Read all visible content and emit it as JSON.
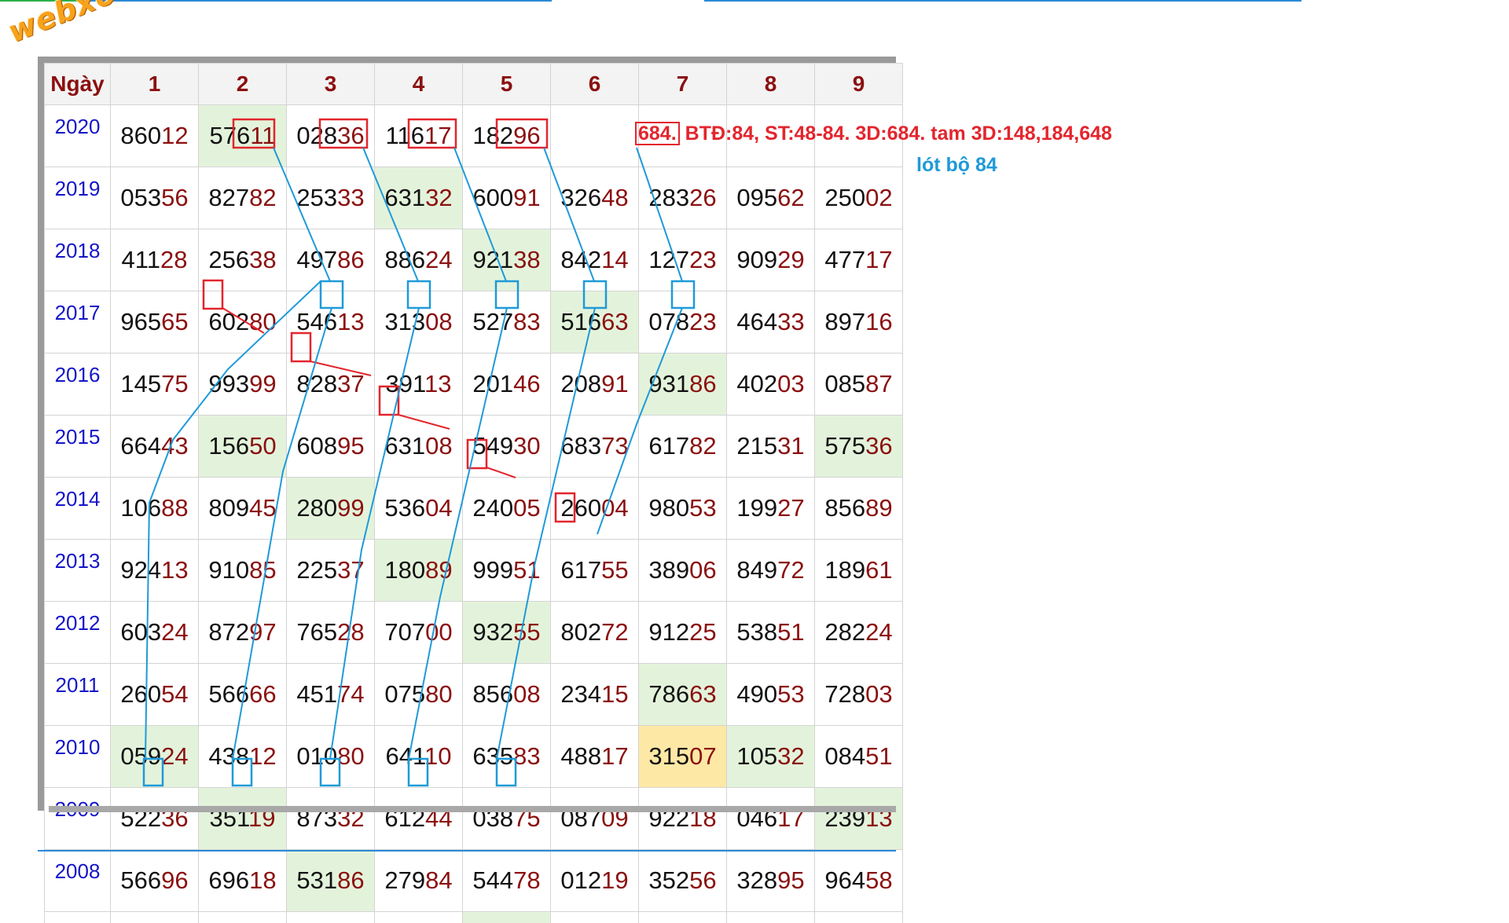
{
  "logo_text": "webxoso.net",
  "header": [
    "Ngày",
    "1",
    "2",
    "3",
    "4",
    "5",
    "6",
    "7",
    "8",
    "9"
  ],
  "rows": [
    {
      "year": "2020",
      "cells": [
        {
          "head": "860",
          "tail": "12"
        },
        {
          "head": "576",
          "tail": "11",
          "bg": "green"
        },
        {
          "head": "028",
          "tail": "36"
        },
        {
          "head": "116",
          "tail": "17"
        },
        {
          "head": "182",
          "tail": "96"
        }
      ]
    },
    {
      "year": "2019",
      "cells": [
        {
          "head": "053",
          "tail": "56"
        },
        {
          "head": "827",
          "tail": "82"
        },
        {
          "head": "253",
          "tail": "33"
        },
        {
          "head": "631",
          "tail": "32",
          "bg": "green"
        },
        {
          "head": "600",
          "tail": "91"
        },
        {
          "head": "326",
          "tail": "48"
        },
        {
          "head": "283",
          "tail": "26"
        },
        {
          "head": "095",
          "tail": "62"
        },
        {
          "head": "250",
          "tail": "02"
        }
      ]
    },
    {
      "year": "2018",
      "cells": [
        {
          "head": "411",
          "tail": "28"
        },
        {
          "head": "256",
          "tail": "38"
        },
        {
          "head": "497",
          "tail": "86"
        },
        {
          "head": "886",
          "tail": "24"
        },
        {
          "head": "921",
          "tail": "38",
          "bg": "green"
        },
        {
          "head": "842",
          "tail": "14"
        },
        {
          "head": "127",
          "tail": "23"
        },
        {
          "head": "909",
          "tail": "29"
        },
        {
          "head": "477",
          "tail": "17"
        }
      ]
    },
    {
      "year": "2017",
      "cells": [
        {
          "head": "965",
          "tail": "65"
        },
        {
          "head": "602",
          "tail": "80"
        },
        {
          "head": "546",
          "tail": "13"
        },
        {
          "head": "313",
          "tail": "08"
        },
        {
          "head": "527",
          "tail": "83"
        },
        {
          "head": "516",
          "tail": "63",
          "bg": "green"
        },
        {
          "head": "078",
          "tail": "23"
        },
        {
          "head": "464",
          "tail": "33"
        },
        {
          "head": "897",
          "tail": "16"
        }
      ]
    },
    {
      "year": "2016",
      "cells": [
        {
          "head": "145",
          "tail": "75"
        },
        {
          "head": "993",
          "tail": "99"
        },
        {
          "head": "828",
          "tail": "37"
        },
        {
          "head": "391",
          "tail": "13"
        },
        {
          "head": "201",
          "tail": "46"
        },
        {
          "head": "208",
          "tail": "91"
        },
        {
          "head": "931",
          "tail": "86",
          "bg": "green"
        },
        {
          "head": "402",
          "tail": "03"
        },
        {
          "head": "085",
          "tail": "87"
        }
      ]
    },
    {
      "year": "2015",
      "cells": [
        {
          "head": "664",
          "tail": "43"
        },
        {
          "head": "156",
          "tail": "50",
          "bg": "green"
        },
        {
          "head": "608",
          "tail": "95"
        },
        {
          "head": "631",
          "tail": "08"
        },
        {
          "head": "549",
          "tail": "30"
        },
        {
          "head": "683",
          "tail": "73"
        },
        {
          "head": "617",
          "tail": "82"
        },
        {
          "head": "215",
          "tail": "31"
        },
        {
          "head": "575",
          "tail": "36",
          "bg": "green"
        }
      ]
    },
    {
      "year": "2014",
      "cells": [
        {
          "head": "106",
          "tail": "88"
        },
        {
          "head": "809",
          "tail": "45"
        },
        {
          "head": "280",
          "tail": "99",
          "bg": "green"
        },
        {
          "head": "536",
          "tail": "04"
        },
        {
          "head": "240",
          "tail": "05"
        },
        {
          "head": "260",
          "tail": "04"
        },
        {
          "head": "980",
          "tail": "53"
        },
        {
          "head": "199",
          "tail": "27"
        },
        {
          "head": "856",
          "tail": "89"
        }
      ]
    },
    {
      "year": "2013",
      "cells": [
        {
          "head": "924",
          "tail": "13"
        },
        {
          "head": "910",
          "tail": "85"
        },
        {
          "head": "225",
          "tail": "37"
        },
        {
          "head": "180",
          "tail": "89",
          "bg": "green"
        },
        {
          "head": "999",
          "tail": "51"
        },
        {
          "head": "617",
          "tail": "55"
        },
        {
          "head": "389",
          "tail": "06"
        },
        {
          "head": "849",
          "tail": "72"
        },
        {
          "head": "189",
          "tail": "61"
        }
      ]
    },
    {
      "year": "2012",
      "cells": [
        {
          "head": "603",
          "tail": "24"
        },
        {
          "head": "872",
          "tail": "97"
        },
        {
          "head": "765",
          "tail": "28"
        },
        {
          "head": "707",
          "tail": "00"
        },
        {
          "head": "932",
          "tail": "55",
          "bg": "green"
        },
        {
          "head": "802",
          "tail": "72"
        },
        {
          "head": "912",
          "tail": "25"
        },
        {
          "head": "538",
          "tail": "51"
        },
        {
          "head": "282",
          "tail": "24"
        }
      ]
    },
    {
      "year": "2011",
      "cells": [
        {
          "head": "260",
          "tail": "54"
        },
        {
          "head": "566",
          "tail": "66"
        },
        {
          "head": "451",
          "tail": "74"
        },
        {
          "head": "075",
          "tail": "80"
        },
        {
          "head": "856",
          "tail": "08"
        },
        {
          "head": "234",
          "tail": "15"
        },
        {
          "head": "786",
          "tail": "63",
          "bg": "green"
        },
        {
          "head": "490",
          "tail": "53"
        },
        {
          "head": "728",
          "tail": "03"
        }
      ]
    },
    {
      "year": "2010",
      "cells": [
        {
          "head": "059",
          "tail": "24",
          "bg": "green"
        },
        {
          "head": "438",
          "tail": "12"
        },
        {
          "head": "010",
          "tail": "80"
        },
        {
          "head": "641",
          "tail": "10"
        },
        {
          "head": "635",
          "tail": "83"
        },
        {
          "head": "488",
          "tail": "17"
        },
        {
          "head": "315",
          "tail": "07",
          "bg": "yellow"
        },
        {
          "head": "105",
          "tail": "32",
          "bg": "green"
        },
        {
          "head": "084",
          "tail": "51"
        }
      ]
    },
    {
      "year": "2009",
      "cells": [
        {
          "head": "522",
          "tail": "36"
        },
        {
          "head": "351",
          "tail": "19",
          "bg": "green"
        },
        {
          "head": "873",
          "tail": "32"
        },
        {
          "head": "612",
          "tail": "44"
        },
        {
          "head": "038",
          "tail": "75"
        },
        {
          "head": "087",
          "tail": "09"
        },
        {
          "head": "922",
          "tail": "18"
        },
        {
          "head": "046",
          "tail": "17"
        },
        {
          "head": "239",
          "tail": "13",
          "bg": "green"
        }
      ]
    },
    {
      "year": "2008",
      "cells": [
        {
          "head": "566",
          "tail": "96"
        },
        {
          "head": "696",
          "tail": "18"
        },
        {
          "head": "531",
          "tail": "86",
          "bg": "green"
        },
        {
          "head": "279",
          "tail": "84"
        },
        {
          "head": "544",
          "tail": "78"
        },
        {
          "head": "012",
          "tail": "19"
        },
        {
          "head": "352",
          "tail": "56"
        },
        {
          "head": "328",
          "tail": "95"
        },
        {
          "head": "964",
          "tail": "58"
        }
      ]
    }
  ],
  "annotation": {
    "boxed": "684.",
    "text": " BTĐ:84, ST:48-84. 3D:684. tam 3D:148,184,648",
    "subtext": "lót bộ 84",
    "red_color": "#e3252d",
    "blue_color": "#1f9ad8"
  }
}
